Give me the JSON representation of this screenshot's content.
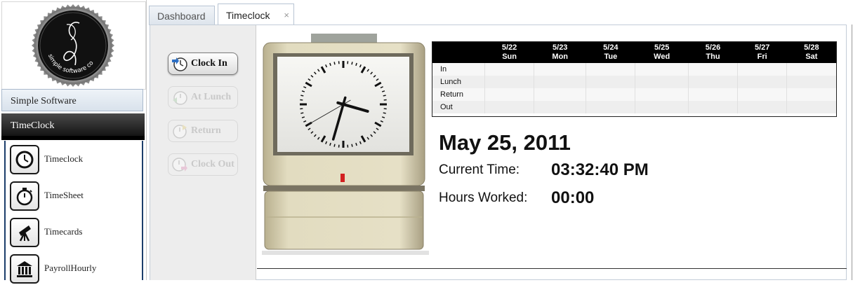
{
  "sidebar": {
    "logo_text": "simple software co",
    "company_name": "Simple Software",
    "section_title": "TimeClock",
    "items": [
      {
        "label": "Timeclock",
        "icon": "clock-icon"
      },
      {
        "label": "TimeSheet",
        "icon": "stopwatch-icon"
      },
      {
        "label": "Timecards",
        "icon": "telescope-icon"
      },
      {
        "label": "PayrollHourly",
        "icon": "bank-icon"
      }
    ]
  },
  "tabs": [
    {
      "label": "Dashboard",
      "active": false
    },
    {
      "label": "Timeclock",
      "active": true,
      "close": "×"
    }
  ],
  "buttons": [
    {
      "label": "Clock In",
      "enabled": true,
      "icon": "clock-in-icon"
    },
    {
      "label": "At Lunch",
      "enabled": false,
      "icon": "lunch-icon"
    },
    {
      "label": "Return",
      "enabled": false,
      "icon": "return-icon"
    },
    {
      "label": "Clock Out",
      "enabled": false,
      "icon": "clock-out-icon"
    }
  ],
  "timecard": {
    "days": [
      {
        "date": "5/22",
        "day": "Sun"
      },
      {
        "date": "5/23",
        "day": "Mon"
      },
      {
        "date": "5/24",
        "day": "Tue"
      },
      {
        "date": "5/25",
        "day": "Wed"
      },
      {
        "date": "5/26",
        "day": "Thu"
      },
      {
        "date": "5/27",
        "day": "Fri"
      },
      {
        "date": "5/28",
        "day": "Sat"
      }
    ],
    "rows": [
      "In",
      "Lunch",
      "Return",
      "Out"
    ]
  },
  "status": {
    "date": "May 25, 2011",
    "current_time_label": "Current Time:",
    "current_time": "03:32:40 PM",
    "hours_worked_label": "Hours Worked:",
    "hours_worked": "00:00"
  },
  "clock_face": {
    "hour": 3,
    "minute": 32,
    "second": 40
  }
}
